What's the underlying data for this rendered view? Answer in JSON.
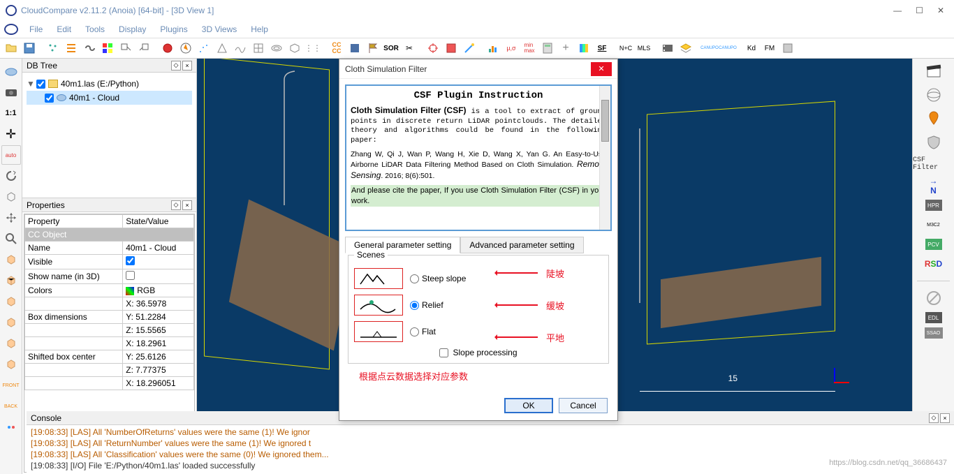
{
  "window": {
    "title": "CloudCompare v2.11.2 (Anoia) [64-bit] - [3D View 1]"
  },
  "menu": [
    "File",
    "Edit",
    "Tools",
    "Display",
    "Plugins",
    "3D Views",
    "Help"
  ],
  "panes": {
    "dbtree": "DB Tree",
    "properties": "Properties",
    "console": "Console"
  },
  "tree": {
    "root": "40m1.las (E:/Python)",
    "child": "40m1 - Cloud"
  },
  "props": {
    "headers": [
      "Property",
      "State/Value"
    ],
    "group": "CC Object",
    "rows": [
      [
        "Name",
        "40m1 - Cloud"
      ],
      [
        "Visible",
        "☑"
      ],
      [
        "Show name (in 3D)",
        "☐"
      ],
      [
        "Colors",
        "RGB"
      ],
      [
        "",
        "X: 36.5978"
      ],
      [
        "Box dimensions",
        "Y: 51.2284"
      ],
      [
        "",
        "Z: 15.5565"
      ],
      [
        "",
        "X: 18.2961"
      ],
      [
        "Shifted box center",
        "Y: 25.6126"
      ],
      [
        "",
        "Z: 7.77375"
      ],
      [
        "",
        "X: 18.296051"
      ]
    ]
  },
  "rightbar": {
    "csf": "CSF Filter",
    "n": "N",
    "hpr": "HPR",
    "m3c2": "M3C2",
    "pcv": "PCV",
    "rsd": "RSD",
    "edl": "EDL",
    "ssao": "SSAO"
  },
  "toolbar_text": {
    "sor": "SOR",
    "sf": "SF",
    "nplusC": "N+C",
    "mls": "MLS",
    "kd": "Kd",
    "fm": "FM",
    "canupo1": "CANUPO",
    "canupo2": "CANUPO"
  },
  "viewport": {
    "scale": "15"
  },
  "console": {
    "l1": "[19:08:33] [LAS] All 'NumberOfReturns' values were the same (1)! We ignor",
    "l2": "[19:08:33] [LAS] All 'ReturnNumber' values were the same (1)! We ignored t",
    "l3": "[19:08:33] [LAS] All 'Classification' values were the same (0)! We ignored them...",
    "l4": "[19:08:33] [I/O] File 'E:/Python/40m1.las' loaded successfully"
  },
  "watermark": "https://blog.csdn.net/qq_36686437",
  "dialog": {
    "title": "Cloth Simulation Filter",
    "heading": "CSF Plugin Instruction",
    "p1": "Cloth Simulation Filter (CSF) is a tool to extract of ground points in discrete return LiDAR pointclouds. The detailed theory and algorithms could be found in the following paper:",
    "ref": "Zhang W, Qi J, Wan P, Wang H, Xie D, Wang X, Yan G. An Easy-to-Use Airborne LiDAR Data Filtering Method Based on Cloth Simulation. Remote Sensing. 2016; 8(6):501.",
    "cite": "And please cite the paper, If you use Cloth Simulation Filter (CSF) in your work.",
    "tab1": "General parameter setting",
    "tab2": "Advanced parameter setting",
    "scenes": "Scenes",
    "steep": "Steep slope",
    "relief": "Relief",
    "flat": "Flat",
    "slope": "Slope processing",
    "tip": "根据点云数据选择对应参数",
    "ann1": "陡坡",
    "ann2": "缓坡",
    "ann3": "平地",
    "ok": "OK",
    "cancel": "Cancel"
  }
}
